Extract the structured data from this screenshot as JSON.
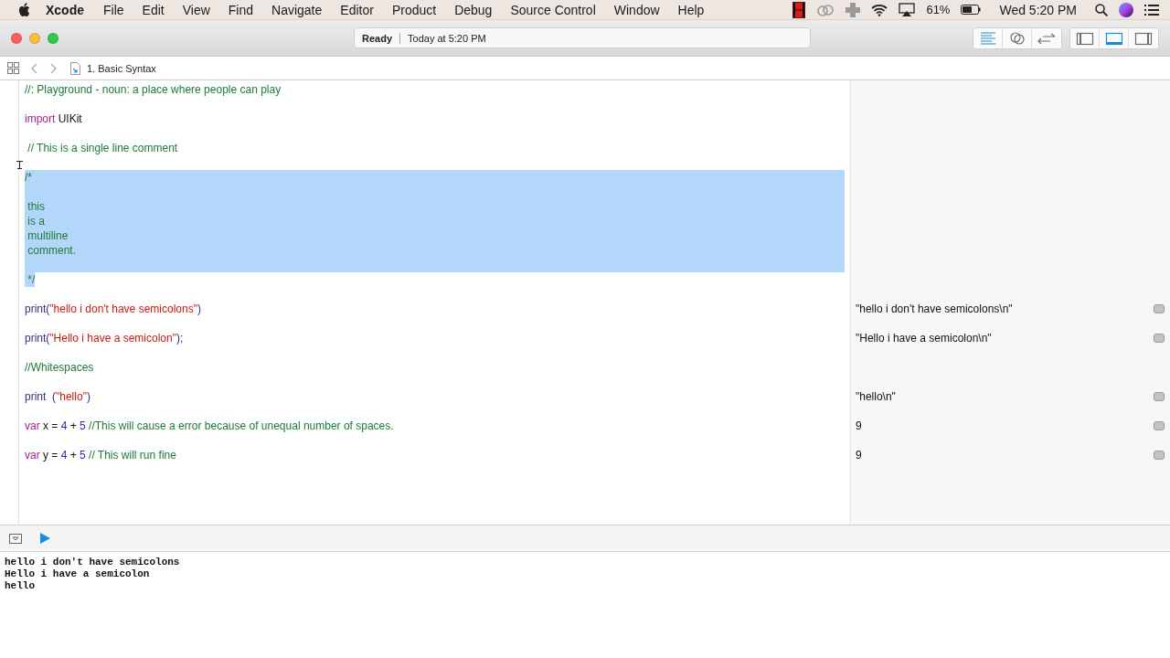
{
  "menu_bar": {
    "app_name": "Xcode",
    "menus": [
      "File",
      "Edit",
      "View",
      "Find",
      "Navigate",
      "Editor",
      "Product",
      "Debug",
      "Source Control",
      "Window",
      "Help"
    ],
    "battery": "61%",
    "clock": "Wed 5:20 PM"
  },
  "toolbar": {
    "status": "Ready",
    "time": "Today at 5:20 PM",
    "editor_modes": [
      {
        "kind": "standard",
        "selected": true
      },
      {
        "kind": "assistant",
        "selected": false
      },
      {
        "kind": "version",
        "selected": false
      }
    ],
    "panels": [
      {
        "kind": "navigator",
        "selected": false
      },
      {
        "kind": "debug",
        "selected": true
      },
      {
        "kind": "utilities",
        "selected": false
      }
    ]
  },
  "jump_bar": {
    "file": "1. Basic Syntax"
  },
  "editor": {
    "lines": [
      {
        "kind": "code",
        "selected": false,
        "tokens": [
          {
            "kind": "comment",
            "text": "//: Playground - noun: a place where people can play"
          }
        ]
      },
      {
        "kind": "blank",
        "selected": false
      },
      {
        "kind": "code",
        "selected": false,
        "tokens": [
          {
            "kind": "keyword",
            "text": "import"
          },
          {
            "kind": "plain",
            "text": " UIKit"
          }
        ]
      },
      {
        "kind": "blank",
        "selected": false
      },
      {
        "kind": "code",
        "selected": false,
        "tokens": [
          {
            "kind": "comment",
            "text": " // This is a single line comment"
          }
        ]
      },
      {
        "kind": "blank",
        "selected": false
      },
      {
        "kind": "code",
        "selected": true,
        "tokens": [
          {
            "kind": "comment",
            "text": "/*"
          }
        ]
      },
      {
        "kind": "blank",
        "selected": true
      },
      {
        "kind": "code",
        "selected": true,
        "tokens": [
          {
            "kind": "comment",
            "text": " this"
          }
        ]
      },
      {
        "kind": "code",
        "selected": true,
        "tokens": [
          {
            "kind": "comment",
            "text": " is a"
          }
        ]
      },
      {
        "kind": "code",
        "selected": true,
        "tokens": [
          {
            "kind": "comment",
            "text": " multiline"
          }
        ]
      },
      {
        "kind": "code",
        "selected": true,
        "tokens": [
          {
            "kind": "comment",
            "text": " comment."
          }
        ]
      },
      {
        "kind": "blank",
        "selected": true
      },
      {
        "kind": "code",
        "selected": true,
        "tokens": [
          {
            "kind": "comment",
            "text": " */"
          }
        ]
      },
      {
        "kind": "blank",
        "selected": false
      },
      {
        "kind": "code",
        "selected": false,
        "tokens": [
          {
            "kind": "call",
            "text": "print("
          },
          {
            "kind": "string",
            "text": "\"hello i don't have semicolons\""
          },
          {
            "kind": "call",
            "text": ")"
          }
        ],
        "result": "\"hello i don't have semicolons\\n\""
      },
      {
        "kind": "blank",
        "selected": false
      },
      {
        "kind": "code",
        "selected": false,
        "tokens": [
          {
            "kind": "call",
            "text": "print("
          },
          {
            "kind": "string",
            "text": "\"Hello i have a semicolon\""
          },
          {
            "kind": "call",
            "text": ");"
          }
        ],
        "result": "\"Hello i have a semicolon\\n\""
      },
      {
        "kind": "blank",
        "selected": false
      },
      {
        "kind": "code",
        "selected": false,
        "tokens": [
          {
            "kind": "comment",
            "text": "//Whitespaces"
          }
        ]
      },
      {
        "kind": "blank",
        "selected": false
      },
      {
        "kind": "code",
        "selected": false,
        "tokens": [
          {
            "kind": "call",
            "text": "print  ("
          },
          {
            "kind": "string",
            "text": "\"hello\""
          },
          {
            "kind": "call",
            "text": ")"
          }
        ],
        "result": "\"hello\\n\""
      },
      {
        "kind": "blank",
        "selected": false
      },
      {
        "kind": "code",
        "selected": false,
        "tokens": [
          {
            "kind": "keyword",
            "text": "var"
          },
          {
            "kind": "plain",
            "text": " x = "
          },
          {
            "kind": "number",
            "text": "4"
          },
          {
            "kind": "plain",
            "text": " + "
          },
          {
            "kind": "number",
            "text": "5"
          },
          {
            "kind": "comment",
            "text": " //This will cause a error because of unequal number of spaces."
          }
        ],
        "result": "9"
      },
      {
        "kind": "blank",
        "selected": false
      },
      {
        "kind": "code",
        "selected": false,
        "tokens": [
          {
            "kind": "keyword",
            "text": "var"
          },
          {
            "kind": "plain",
            "text": " y = "
          },
          {
            "kind": "number",
            "text": "4"
          },
          {
            "kind": "plain",
            "text": " + "
          },
          {
            "kind": "number",
            "text": "5"
          },
          {
            "kind": "comment",
            "text": " // This will run fine"
          }
        ],
        "result": "9"
      }
    ]
  },
  "console": {
    "lines": [
      "hello i don't have semicolons",
      "Hello i have a semicolon",
      "hello"
    ]
  }
}
